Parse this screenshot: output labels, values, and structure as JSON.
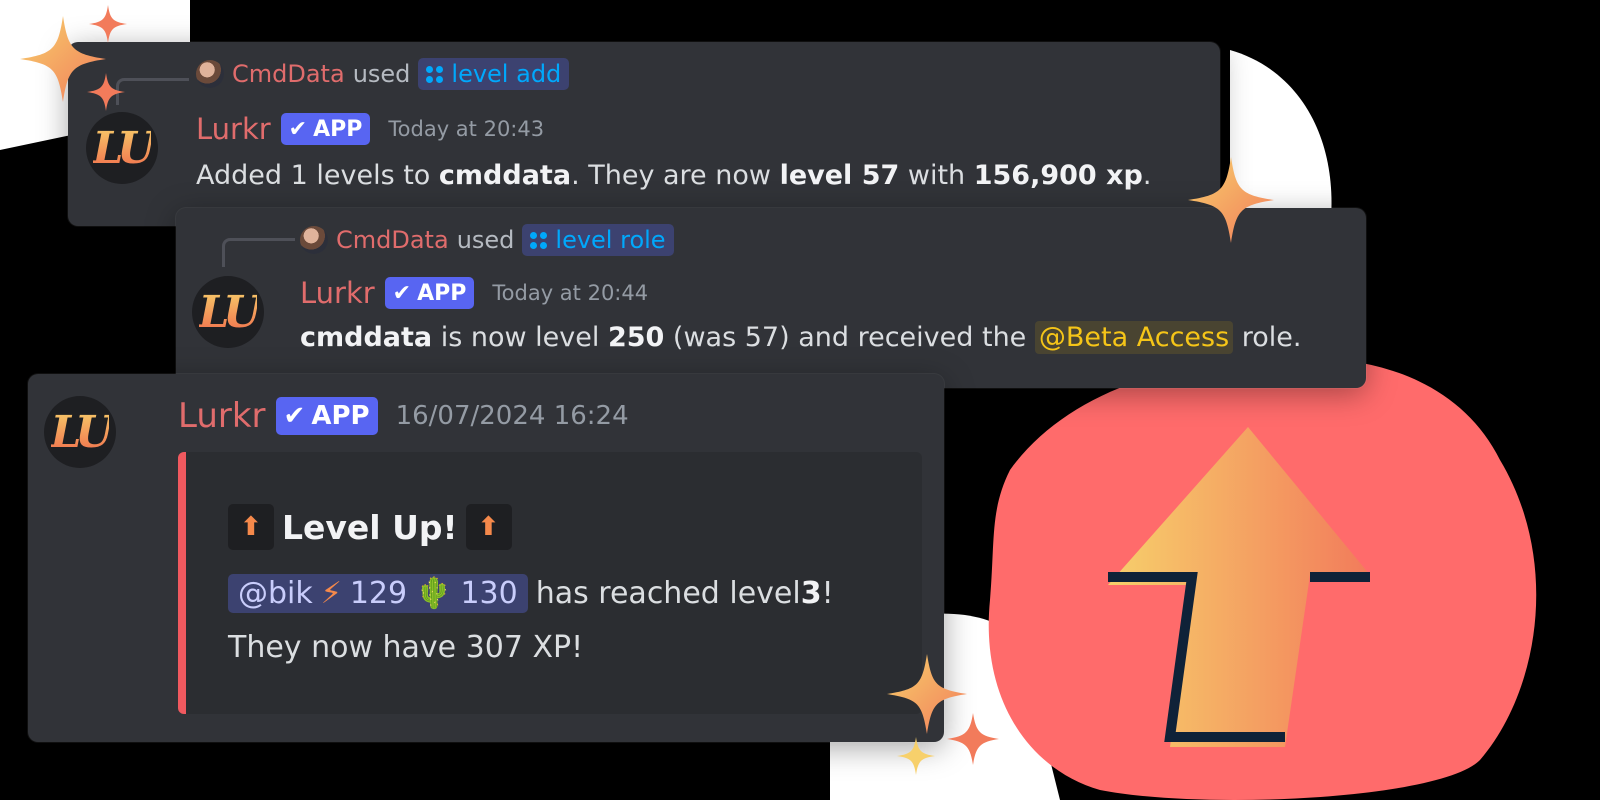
{
  "reply1": {
    "user": "CmdData",
    "verb": "used",
    "command": "level add"
  },
  "message1": {
    "author": "Lurkr",
    "badge": "APP",
    "timestamp": "Today at 20:43",
    "text": {
      "p1": "Added 1 levels to ",
      "user": "cmddata",
      "p2": ". They are now ",
      "level": "level 57",
      "p3": " with ",
      "xp": "156,900 xp",
      "p4": "."
    }
  },
  "reply2": {
    "user": "CmdData",
    "verb": "used",
    "command": "level role"
  },
  "message2": {
    "author": "Lurkr",
    "badge": "APP",
    "timestamp": "Today at 20:44",
    "text": {
      "user": "cmddata",
      "p1": " is now level ",
      "level": "250",
      "p2": " (was 57) and received the ",
      "role": "@Beta Access",
      "p3": " role."
    }
  },
  "message3": {
    "author": "Lurkr",
    "badge": "APP",
    "timestamp": "16/07/2024 16:24",
    "embed": {
      "title": "Level Up!",
      "mention": "@bik",
      "stat1": "129",
      "stat2": "130",
      "line1_text": "has reached level ",
      "line1_level": "3",
      "line1_end": "!",
      "line2": "They now have 307 XP!"
    }
  },
  "icons": {
    "avatar": "lurkr-logo-icon",
    "command": "slash-command-icon",
    "verified": "check-icon",
    "level_up": "arrow-up-icon",
    "bolt": "lightning-icon",
    "cactus": "cactus-icon",
    "decor": "sparkle-icon"
  },
  "colors": {
    "accent_red": "#e06c6c",
    "app_badge": "#5865f2",
    "command_blue": "#00a8fc",
    "embed_bar": "#f0595f",
    "role_yellow": "#f5c518",
    "background_blob": "#ff6b6b"
  }
}
